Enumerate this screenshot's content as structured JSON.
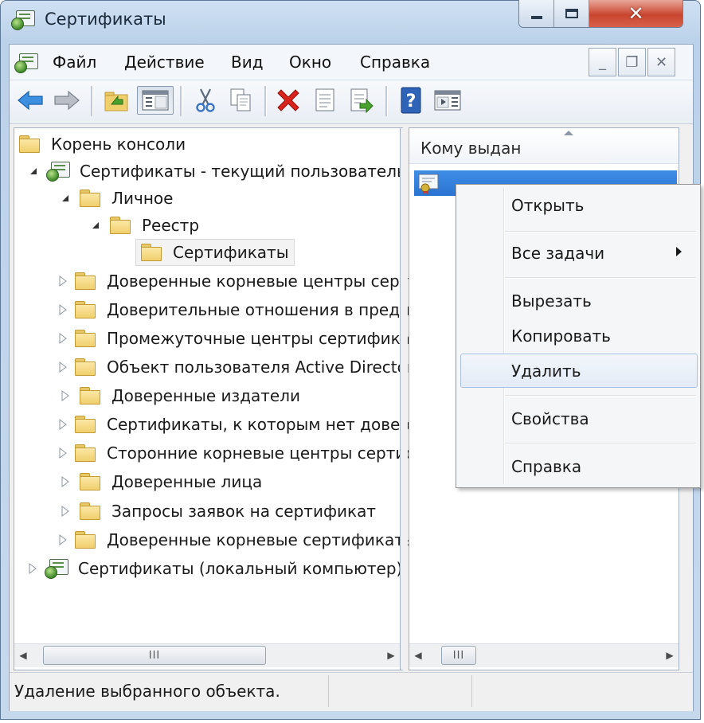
{
  "window": {
    "title": "Сертификаты"
  },
  "menubar": {
    "items": [
      "Файл",
      "Действие",
      "Вид",
      "Окно",
      "Справка"
    ]
  },
  "tree": {
    "items": [
      {
        "label": "Корень консоли"
      },
      {
        "label": "Сертификаты - текущий пользователь"
      },
      {
        "label": "Личное"
      },
      {
        "label": "Реестр"
      },
      {
        "label": "Сертификаты"
      },
      {
        "label": "Доверенные корневые центры сертификации"
      },
      {
        "label": "Доверительные отношения в предприятии"
      },
      {
        "label": "Промежуточные центры сертификации"
      },
      {
        "label": "Объект пользователя Active Directory"
      },
      {
        "label": "Доверенные издатели"
      },
      {
        "label": "Сертификаты, к которым нет доверия"
      },
      {
        "label": "Сторонние корневые центры сертификации"
      },
      {
        "label": "Доверенные лица"
      },
      {
        "label": "Запросы заявок на сертификат"
      },
      {
        "label": "Доверенные корневые сертификаты смарт-карты"
      },
      {
        "label": "Сертификаты (локальный компьютер)"
      }
    ]
  },
  "list": {
    "column_header": "Кому выдан"
  },
  "scrollbar": {
    "thumb_grip": "III"
  },
  "context_menu": {
    "items": [
      "Открыть",
      "Все задачи",
      "Вырезать",
      "Копировать",
      "Удалить",
      "Свойства",
      "Справка"
    ],
    "highlighted": "Удалить"
  },
  "statusbar": {
    "text": "Удаление выбранного объекта."
  },
  "colors": {
    "selection_blue": "#2a73d0",
    "delete_red": "#d9231c",
    "folder_yellow": "#f0cf6d"
  }
}
